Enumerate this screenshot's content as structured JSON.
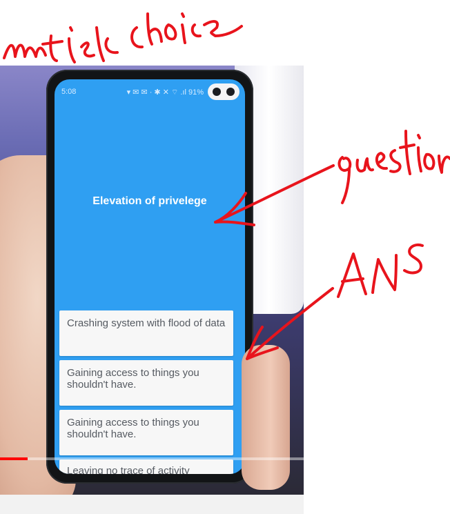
{
  "phone": {
    "status_time": "5:08",
    "status_icons_text": "▾ ✉ ✉ ·   ✱ ✕ ⌔ .ıl 91%",
    "question": "Elevation of privelege",
    "answers": [
      {
        "text": "Crashing system with flood of data"
      },
      {
        "text": "Gaining access to things you shouldn't have."
      },
      {
        "text": "Gaining access to things you shouldn't have."
      },
      {
        "text": "Leaving no trace of activity"
      }
    ]
  },
  "video": {
    "progress_fraction": 0.09
  },
  "handwriting": {
    "color": "#e8141c",
    "top_label": "mutiple choice",
    "question_label": "question",
    "ans_label": "ANS"
  },
  "colors": {
    "screen": "#2f9ff2",
    "answer_card": "#f7f7f7",
    "progress_played": "#ff0000"
  }
}
